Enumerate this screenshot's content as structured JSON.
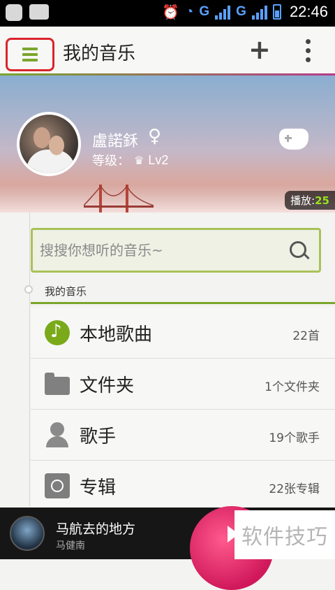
{
  "status_bar": {
    "time": "22:46",
    "network1": "G",
    "network2": "G",
    "icons": [
      "notification-icon",
      "message-icon",
      "alarm-icon",
      "wifi-icon",
      "signal-icon",
      "battery-icon"
    ]
  },
  "header": {
    "title": "我的音乐",
    "annotation_arrow": "←"
  },
  "profile": {
    "username": "盧諾鉌",
    "gender_symbol": "♀",
    "level_label": "等级：",
    "level_value": "Lv2",
    "play_label": "播放:",
    "play_count": "25"
  },
  "search": {
    "placeholder": "搜搜你想听的音乐~"
  },
  "section": {
    "label": "我的音乐"
  },
  "library": [
    {
      "label": "本地歌曲",
      "count": "22首",
      "icon": "music-note-icon"
    },
    {
      "label": "文件夹",
      "count": "1个文件夹",
      "icon": "folder-icon"
    },
    {
      "label": "歌手",
      "count": "19个歌手",
      "icon": "person-icon"
    },
    {
      "label": "专辑",
      "count": "22张专辑",
      "icon": "album-disc-icon"
    }
  ],
  "player": {
    "song": "马航去的地方",
    "artist": "马健南"
  },
  "watermark": "软件技巧",
  "colors": {
    "accent_green": "#7aa62c",
    "accent_pink": "#d0185a",
    "highlight_red": "#d9262c"
  }
}
